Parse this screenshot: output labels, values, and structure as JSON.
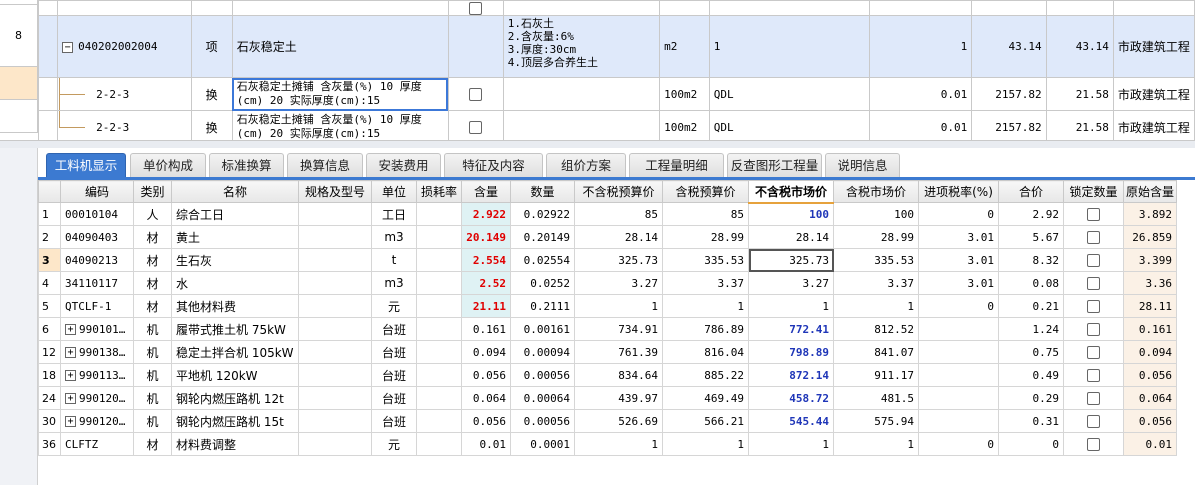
{
  "top_rows": [
    {
      "num": "",
      "code": "",
      "type": "",
      "name": "",
      "checkbox": true,
      "desc": [],
      "unit": "",
      "qty_expr": "",
      "qty": "",
      "price": "",
      "total": "",
      "category": ""
    },
    {
      "num": "8",
      "code": "040202002004",
      "type": "项",
      "name": "石灰稳定土",
      "checkbox": false,
      "desc": [
        "1.石灰土",
        "2.含灰量:6%",
        "3.厚度:30cm",
        "4.顶层多合养生土"
      ],
      "unit": "m2",
      "qty_expr": "1",
      "qty": "1",
      "price": "43.14",
      "total": "43.14",
      "category": "市政建筑工程"
    },
    {
      "num": "",
      "code": "2-2-3",
      "type": "换",
      "name": "石灰稳定土摊铺 含灰量(%) 10 厚度(cm) 20 实际厚度(cm):15",
      "checkbox": true,
      "desc": [],
      "unit": "100m2",
      "qty_expr": "QDL",
      "qty": "0.01",
      "price": "2157.82",
      "total": "21.58",
      "category": "市政建筑工程"
    },
    {
      "num": "",
      "code": "2-2-3",
      "type": "换",
      "name": "石灰稳定土摊铺 含灰量(%) 10 厚度(cm) 20 实际厚度(cm):15",
      "checkbox": true,
      "desc": [],
      "unit": "100m2",
      "qty_expr": "QDL",
      "qty": "0.01",
      "price": "2157.82",
      "total": "21.58",
      "category": "市政建筑工程"
    }
  ],
  "tabs": [
    "工料机显示",
    "单价构成",
    "标准换算",
    "换算信息",
    "安装费用",
    "特征及内容",
    "组价方案",
    "工程量明细",
    "反查图形工程量",
    "说明信息"
  ],
  "columns": [
    "编码",
    "类别",
    "名称",
    "规格及型号",
    "单位",
    "损耗率",
    "含量",
    "数量",
    "不含税预算价",
    "含税预算价",
    "不含税市场价",
    "含税市场价",
    "进项税率(%)",
    "合价",
    "锁定数量",
    "原始含量"
  ],
  "rows": [
    {
      "n": "1",
      "code": "00010104",
      "cat": "人",
      "name": "综合工日",
      "spec": "",
      "unit": "工日",
      "loss": "",
      "content": "2.922",
      "qty": "0.02922",
      "pre_notax": "85",
      "pre_tax": "85",
      "mkt_notax": "100",
      "mkt_tax": "100",
      "tax": "0",
      "total": "2.92",
      "orig": "3.892",
      "red": true,
      "blue": true
    },
    {
      "n": "2",
      "code": "04090403",
      "cat": "材",
      "name": "黄土",
      "spec": "",
      "unit": "m3",
      "loss": "",
      "content": "20.149",
      "qty": "0.20149",
      "pre_notax": "28.14",
      "pre_tax": "28.99",
      "mkt_notax": "28.14",
      "mkt_tax": "28.99",
      "tax": "3.01",
      "total": "5.67",
      "orig": "26.859",
      "red": true,
      "blue": false
    },
    {
      "n": "3",
      "code": "04090213",
      "cat": "材",
      "name": "生石灰",
      "spec": "",
      "unit": "t",
      "loss": "",
      "content": "2.554",
      "qty": "0.02554",
      "pre_notax": "325.73",
      "pre_tax": "335.53",
      "mkt_notax": "325.73",
      "mkt_tax": "335.53",
      "tax": "3.01",
      "total": "8.32",
      "orig": "3.399",
      "red": true,
      "blue": false,
      "cur": true
    },
    {
      "n": "4",
      "code": "34110117",
      "cat": "材",
      "name": "水",
      "spec": "",
      "unit": "m3",
      "loss": "",
      "content": "2.52",
      "qty": "0.0252",
      "pre_notax": "3.27",
      "pre_tax": "3.37",
      "mkt_notax": "3.27",
      "mkt_tax": "3.37",
      "tax": "3.01",
      "total": "0.08",
      "orig": "3.36",
      "red": true,
      "blue": false
    },
    {
      "n": "5",
      "code": "QTCLF-1",
      "cat": "材",
      "name": "其他材料费",
      "spec": "",
      "unit": "元",
      "loss": "",
      "content": "21.11",
      "qty": "0.2111",
      "pre_notax": "1",
      "pre_tax": "1",
      "mkt_notax": "1",
      "mkt_tax": "1",
      "tax": "0",
      "total": "0.21",
      "orig": "28.11",
      "red": true,
      "blue": false
    },
    {
      "n": "6",
      "code": "990101…",
      "expand": true,
      "cat": "机",
      "name": "履带式推土机 75kW",
      "spec": "",
      "unit": "台班",
      "loss": "",
      "content": "0.161",
      "qty": "0.00161",
      "pre_notax": "734.91",
      "pre_tax": "786.89",
      "mkt_notax": "772.41",
      "mkt_tax": "812.52",
      "tax": "",
      "total": "1.24",
      "orig": "0.161",
      "red": false,
      "blue": true
    },
    {
      "n": "12",
      "code": "990138…",
      "expand": true,
      "cat": "机",
      "name": "稳定土拌合机 105kW",
      "spec": "",
      "unit": "台班",
      "loss": "",
      "content": "0.094",
      "qty": "0.00094",
      "pre_notax": "761.39",
      "pre_tax": "816.04",
      "mkt_notax": "798.89",
      "mkt_tax": "841.07",
      "tax": "",
      "total": "0.75",
      "orig": "0.094",
      "red": false,
      "blue": true
    },
    {
      "n": "18",
      "code": "990113…",
      "expand": true,
      "cat": "机",
      "name": "平地机 120kW",
      "spec": "",
      "unit": "台班",
      "loss": "",
      "content": "0.056",
      "qty": "0.00056",
      "pre_notax": "834.64",
      "pre_tax": "885.22",
      "mkt_notax": "872.14",
      "mkt_tax": "911.17",
      "tax": "",
      "total": "0.49",
      "orig": "0.056",
      "red": false,
      "blue": true
    },
    {
      "n": "24",
      "code": "990120…",
      "expand": true,
      "cat": "机",
      "name": "钢轮内燃压路机 12t",
      "spec": "",
      "unit": "台班",
      "loss": "",
      "content": "0.064",
      "qty": "0.00064",
      "pre_notax": "439.97",
      "pre_tax": "469.49",
      "mkt_notax": "458.72",
      "mkt_tax": "481.5",
      "tax": "",
      "total": "0.29",
      "orig": "0.064",
      "red": false,
      "blue": true
    },
    {
      "n": "30",
      "code": "990120…",
      "expand": true,
      "cat": "机",
      "name": "钢轮内燃压路机 15t",
      "spec": "",
      "unit": "台班",
      "loss": "",
      "content": "0.056",
      "qty": "0.00056",
      "pre_notax": "526.69",
      "pre_tax": "566.21",
      "mkt_notax": "545.44",
      "mkt_tax": "575.94",
      "tax": "",
      "total": "0.31",
      "orig": "0.056",
      "red": false,
      "blue": true
    },
    {
      "n": "36",
      "code": "CLFTZ",
      "cat": "材",
      "name": "材料费调整",
      "spec": "",
      "unit": "元",
      "loss": "",
      "content": "0.01",
      "qty": "0.0001",
      "pre_notax": "1",
      "pre_tax": "1",
      "mkt_notax": "1",
      "mkt_tax": "1",
      "tax": "0",
      "total": "0",
      "orig": "0.01",
      "red": false,
      "blue": false
    }
  ]
}
